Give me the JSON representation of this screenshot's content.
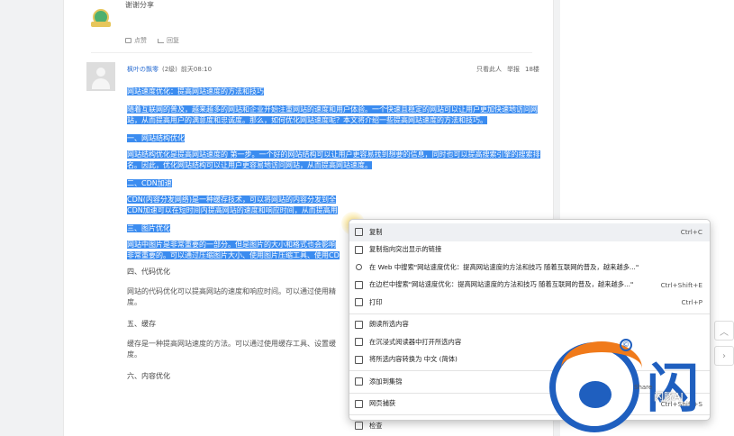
{
  "top_reply": {
    "text": "谢谢分享",
    "like": "点赞",
    "reply": "回复"
  },
  "post": {
    "username": "枫叶の飘零",
    "level": "(2级)",
    "time": "前天08:10",
    "view_author": "只看此人",
    "report": "举报",
    "floor": "18楼"
  },
  "article": {
    "title": "网站速度优化：提高网站速度的方法和技巧",
    "intro": "随着互联网的普及，越来越多的网站和企业开始注重网站的速度和用户体验。一个快速且稳定的网站可以让用户更加快速地访问网站，从而提高用户的满意度和忠诚度。那么，如何优化网站速度呢？本文将介绍一些提高网站速度的方法和技巧。",
    "s1_title": "一、网站结构优化",
    "s1_body": "网站结构优化是提高网站速度的 第一步。一个好的网站结构可以让用户更容易找到想要的信息，同时也可以提高搜索引擎的搜索排名。因此，优化网站结构可以让用户更容易地访问网站，从而提高网站速度。",
    "s2_title": "二、CDN加速",
    "s2_body": "CDN(内容分发网络)是一种缓存技术，可以将网站的内容分发到全",
    "s2_body2": "CDN加速可以在短时间内提高网站的速度和响应时间，从而提高用",
    "s3_title": "三、图片优化",
    "s3_body": "网站中图片是非常重要的一部分。但是图片的大小和格式也会影响",
    "s3_body2": "非常重要的。可以通过压缩图片大小、使用图片压缩工具、使用CD",
    "s4_title": "四、代码优化",
    "s4_body": "网站的代码优化可以提高网站的速度和响应时间。可以通过使用精",
    "s4_body2": "度。",
    "s5_title": "五、缓存",
    "s5_body": "缓存是一种提高网站速度的方法。可以通过使用缓存工具、设置缓",
    "s5_body2": "度。",
    "s6_title": "六、内容优化"
  },
  "context_menu": {
    "items": [
      {
        "label": "复制",
        "shortcut": "Ctrl+C"
      },
      {
        "label": "复制指向突出显示的链接",
        "shortcut": ""
      },
      {
        "label": "在 Web 中搜索\"网站速度优化：提高网站速度的方法和技巧 随着互联网的普及，越来越多...\"",
        "shortcut": ""
      },
      {
        "label": "在边栏中搜索\"网站速度优化：提高网站速度的方法和技巧 随着互联网的普及，越来越多...\"",
        "shortcut": "Ctrl+Shift+E"
      },
      {
        "label": "打印",
        "shortcut": "Ctrl+P"
      },
      {
        "label": "朗读所选内容",
        "shortcut": ""
      },
      {
        "label": "在沉浸式阅读器中打开所选内容",
        "shortcut": ""
      },
      {
        "label": "将所选内容转换为 中文 (简体)",
        "shortcut": ""
      },
      {
        "label": "添加到集锦",
        "shortcut": ""
      },
      {
        "label": "网页捕获",
        "shortcut": "Ctrl+Shift+S"
      },
      {
        "label": "检查",
        "shortcut": ""
      }
    ]
  },
  "watermark": {
    "char": "闪",
    "copyright": "©",
    "subtitle": "闪豚AI",
    "share": "Share"
  },
  "side_buttons": {
    "up": "︿",
    "right": "›"
  },
  "colors": {
    "selection": "#3b8cf0",
    "link": "#2d6fd2",
    "brand_blue": "#1f5fbf",
    "brand_orange": "#f07a1a"
  }
}
